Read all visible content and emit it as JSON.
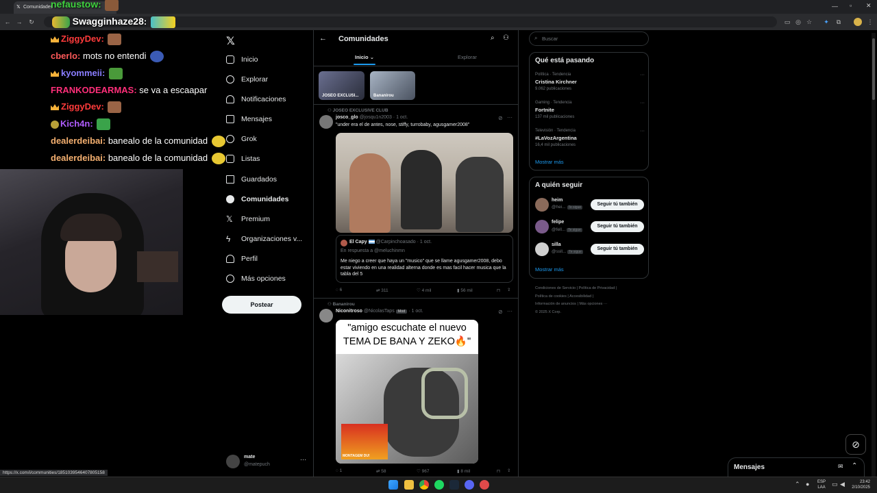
{
  "browser": {
    "tab_title": "Comunidades",
    "status_url": "https://x.com/i/communities/1851039546407805158"
  },
  "stream_chat": [
    {
      "user": "nefaustow",
      "sep": ":",
      "msg": "",
      "color": "#3ed33e",
      "badge": "none"
    },
    {
      "user": "Swagginhaze28",
      "sep": ":",
      "msg": "",
      "color": "#ffffff",
      "badge": "emoji"
    },
    {
      "user": "ZiggyDev",
      "sep": ":",
      "msg": "",
      "color": "#ff3b3b",
      "badge": "crown"
    },
    {
      "user": "cberlo",
      "sep": ":",
      "msg": " mots no entendi",
      "color": "#ff5a5a",
      "badge": "none"
    },
    {
      "user": "kyommeii",
      "sep": ":",
      "msg": "",
      "color": "#8a7dff",
      "badge": "crown"
    },
    {
      "user": "FRANKODEARMAS",
      "sep": ":",
      "msg": " se va a escaapar",
      "color": "#ff2f7a",
      "badge": "none"
    },
    {
      "user": "ZiggyDev",
      "sep": ":",
      "msg": "",
      "color": "#ff3b3b",
      "badge": "crown"
    },
    {
      "user": "Kich4n",
      "sep": ":",
      "msg": "",
      "color": "#b05cff",
      "badge": "emoji"
    },
    {
      "user": "dealerdeibai",
      "sep": ":",
      "msg": " banealo de la comunidad",
      "color": "#f5b070",
      "badge": "none"
    },
    {
      "user": "dealerdeibai",
      "sep": ":",
      "msg": " banealo de la comunidad",
      "color": "#f5b070",
      "badge": "none"
    }
  ],
  "nav": {
    "items": [
      {
        "label": "Inicio",
        "icon": "home-icon"
      },
      {
        "label": "Explorar",
        "icon": "search-icon"
      },
      {
        "label": "Notificaciones",
        "icon": "bell-icon"
      },
      {
        "label": "Mensajes",
        "icon": "mail-icon"
      },
      {
        "label": "Grok",
        "icon": "grok-icon"
      },
      {
        "label": "Listas",
        "icon": "list-icon"
      },
      {
        "label": "Guardados",
        "icon": "bookmark-icon"
      },
      {
        "label": "Comunidades",
        "icon": "communities-icon"
      },
      {
        "label": "Premium",
        "icon": "x-icon"
      },
      {
        "label": "Organizaciones v...",
        "icon": "lightning-icon"
      },
      {
        "label": "Perfil",
        "icon": "person-icon"
      },
      {
        "label": "Más opciones",
        "icon": "more-icon"
      }
    ],
    "post_button": "Postear",
    "account": {
      "name": "mate",
      "handle": "@matepuch"
    }
  },
  "center": {
    "title": "Comunidades",
    "tabs": [
      "Inicio",
      "Explorar"
    ],
    "communities": [
      "JOSEO EXCLUSI...",
      "Bananirou"
    ],
    "tweet1": {
      "community": "JOSEO EXCLUSIVE CLUB",
      "name": "josco_glo",
      "handle": "@josqu1n2003",
      "date": "· 1 oct.",
      "text": "\"under era el de antes, nose, stiffy, turrobaby, agusgamer2008\"",
      "quote_name": "El Capy",
      "quote_handle": "@Carpinchoasado",
      "quote_date": "· 1 oct.",
      "quote_reply": "En respuesta a @meluchinmn",
      "quote_text": "Me niego a creer que haya un \"musico\" que se llame agusgamer2008, debo estar viviendo en una realidad alterna donde es mas facil hacer musica que la tabla del 5",
      "replies": "6",
      "reposts": "311",
      "likes": "4 mil",
      "views": "56 mil"
    },
    "tweet2": {
      "community": "Bananirou",
      "name": "Niconitroso",
      "handle": "@NicolasTaps",
      "badge": "Mod",
      "date": "· 1 oct.",
      "meme_caption": "\"amigo escuchate el nuevo TEMA DE BANA Y ZEKO🔥\"",
      "album_text": "MONTAGEM DU!",
      "replies": "1",
      "reposts": "58",
      "likes": "967",
      "views": "8 mil"
    }
  },
  "right": {
    "search_placeholder": "Buscar",
    "trends_title": "Qué está pasando",
    "trends": [
      {
        "category": "Política · Tendencia",
        "name": "Cristina Kirchner",
        "count": "9.062 publicaciones"
      },
      {
        "category": "Gaming · Tendencia",
        "name": "Fortnite",
        "count": "137 mil publicaciones"
      },
      {
        "category": "Televisión · Tendencia",
        "name": "#LaVozArgentina",
        "count": "16,4 mil publicaciones"
      }
    ],
    "show_more": "Mostrar más",
    "follow_title": "A quién seguir",
    "follow": [
      {
        "name": "heim",
        "handle": "@hei...",
        "tag": "Te sigue",
        "btn": "Seguir tú también"
      },
      {
        "name": "felipe",
        "handle": "@fell...",
        "tag": "Te sigue",
        "btn": "Seguir tú también"
      },
      {
        "name": "silla",
        "handle": "@ssll...",
        "tag": "Te sigue",
        "btn": "Seguir tú también"
      }
    ],
    "show_more2": "Mostrar más",
    "footer": [
      "Condiciones de Servicio",
      "|",
      "Política de Privacidad",
      "|",
      "Política de cookies",
      "|",
      "Accesibilidad",
      "|",
      "Información de anuncios",
      "|",
      "Más opciones ···",
      "© 2025 X Corp."
    ],
    "messages_title": "Mensajes"
  },
  "taskbar": {
    "lang1": "ESP",
    "lang2": "LAA",
    "time": "23:42",
    "date": "2/10/2025"
  }
}
